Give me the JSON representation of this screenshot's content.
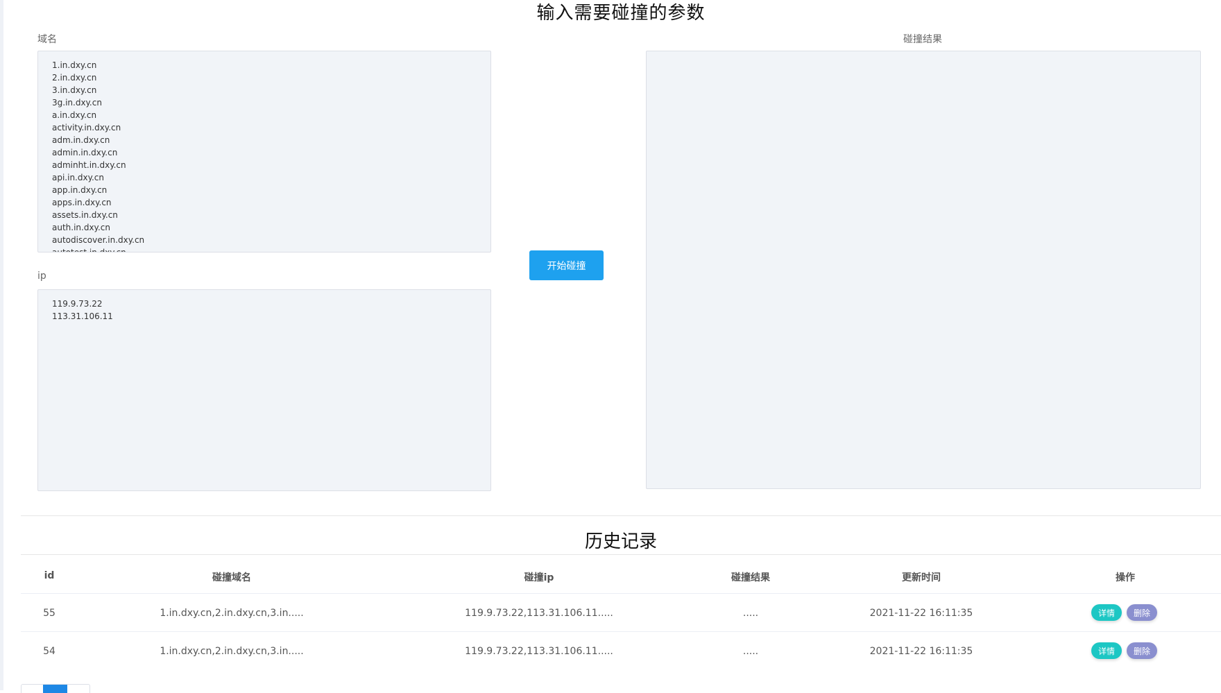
{
  "title": "输入需要碰撞的参数",
  "domain_label": "域名",
  "domains": [
    "1.in.dxy.cn",
    "2.in.dxy.cn",
    "3.in.dxy.cn",
    "3g.in.dxy.cn",
    "a.in.dxy.cn",
    "activity.in.dxy.cn",
    "adm.in.dxy.cn",
    "admin.in.dxy.cn",
    "adminht.in.dxy.cn",
    "api.in.dxy.cn",
    "app.in.dxy.cn",
    "apps.in.dxy.cn",
    "assets.in.dxy.cn",
    "auth.in.dxy.cn",
    "autodiscover.in.dxy.cn",
    "autotest.in.dxy.cn"
  ],
  "ip_label": "ip",
  "ips": [
    "119.9.73.22",
    "113.31.106.11"
  ],
  "result_label": "碰撞结果",
  "start_button": "开始碰撞",
  "history_title": "历史记录",
  "table": {
    "headers": [
      "id",
      "碰撞域名",
      "碰撞ip",
      "碰撞结果",
      "更新时间",
      "操作"
    ],
    "rows": [
      {
        "id": "55",
        "domains": "1.in.dxy.cn,2.in.dxy.cn,3.in.....",
        "ips": "119.9.73.22,113.31.106.11.....",
        "result": ".....",
        "time": "2021-11-22 16:11:35"
      },
      {
        "id": "54",
        "domains": "1.in.dxy.cn,2.in.dxy.cn,3.in.....",
        "ips": "119.9.73.22,113.31.106.11.....",
        "result": ".....",
        "time": "2021-11-22 16:11:35"
      }
    ],
    "detail_label": "详情",
    "delete_label": "删除"
  },
  "colors": {
    "primary": "#1ea1ef",
    "detail": "#1dc7c4",
    "delete": "#8a8fcf",
    "textarea_bg": "#f1f4f8"
  }
}
